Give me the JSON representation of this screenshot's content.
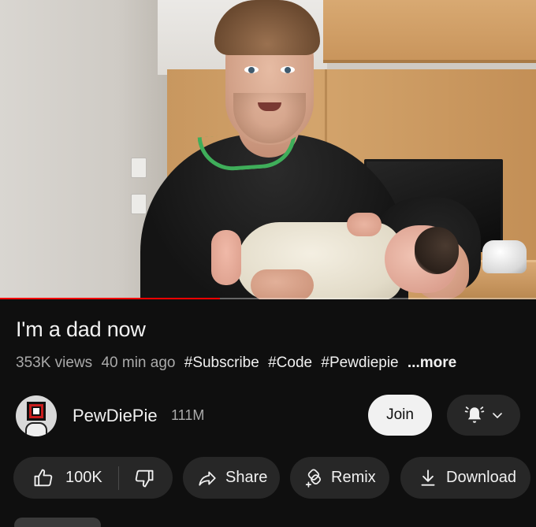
{
  "video": {
    "progress_fraction": 0.41
  },
  "title": "I'm a dad now",
  "meta": {
    "views": "353K views",
    "age": "40 min ago",
    "hashtags": [
      "#Subscribe",
      "#Code",
      "#Pewdiepie"
    ],
    "more_label": "...more"
  },
  "channel": {
    "name": "PewDiePie",
    "subscribers": "111M",
    "join_label": "Join",
    "bell_icon": "bell-icon",
    "dropdown_icon": "chevron-down-icon"
  },
  "actions": {
    "like_count": "100K",
    "share_label": "Share",
    "remix_label": "Remix",
    "download_label": "Download"
  },
  "colors": {
    "background": "#0f0f0f",
    "pill": "#272727",
    "text_primary": "#f1f1f1",
    "text_secondary": "#aaaaaa",
    "progress": "#ff0000"
  }
}
